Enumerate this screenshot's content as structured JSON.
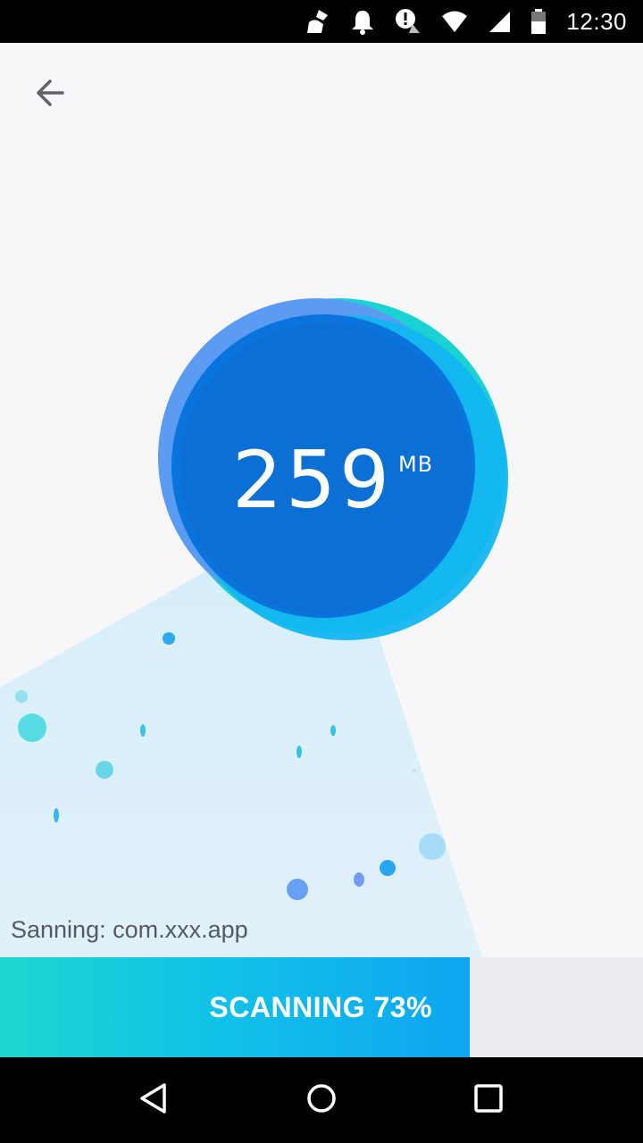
{
  "status_bar": {
    "time": "12:30",
    "icons": [
      "cleaner-broom-icon",
      "notification-bell-icon",
      "alert-icon",
      "wifi-icon",
      "signal-icon",
      "battery-icon"
    ]
  },
  "header": {
    "back_icon": "arrow-left-icon"
  },
  "scan_result": {
    "size_value": "259",
    "size_unit": "MB"
  },
  "scan_status_text": "Sanning: com.xxx.app",
  "progress": {
    "label": "SCANNING 73%",
    "percent": 73
  },
  "colors": {
    "accent_teal": "#1dd6cf",
    "accent_blue": "#0a70d8",
    "progress_end": "#0ea6f2",
    "track": "#ececf2"
  },
  "nav_bar": {
    "icons": [
      "back-triangle-icon",
      "home-circle-icon",
      "recents-square-icon"
    ]
  }
}
